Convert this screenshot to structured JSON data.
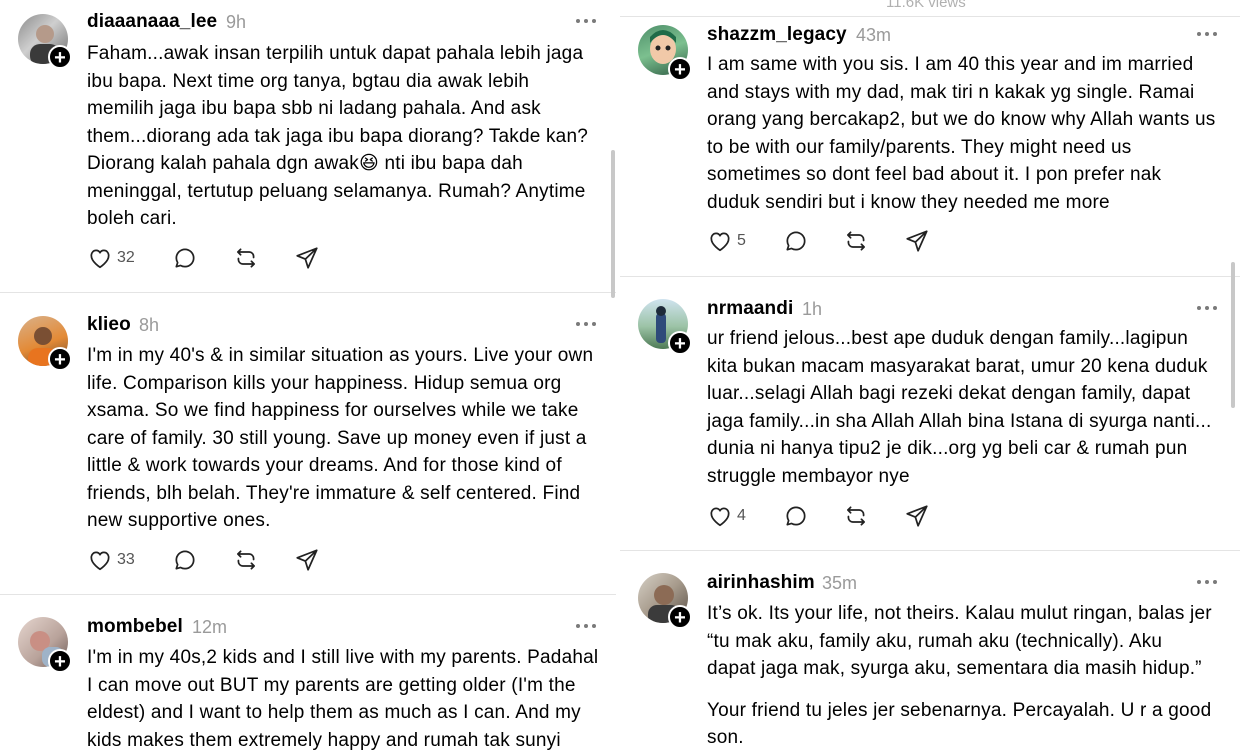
{
  "left_posts": [
    {
      "username": "diaaanaaa_lee",
      "time": "9h",
      "lines": [
        "Faham...awak insan terpilih untuk dapat pahala lebih jaga",
        "ibu bapa. Next time org tanya, bgtau dia awak lebih",
        "memilih jaga ibu bapa sbb ni ladang pahala. And ask",
        "them...diorang ada tak jaga ibu bapa diorang? Takde kan?",
        "Diorang kalah pahala dgn awak😆 nti ibu bapa dah",
        "meninggal, tertutup peluang selamanya. Rumah? Anytime",
        "boleh cari."
      ],
      "likes": "32"
    },
    {
      "username": "klieo",
      "time": "8h",
      "lines": [
        "I'm in my 40's & in similar situation as yours. Live your own",
        "life. Comparison kills your happiness. Hidup semua org",
        "xsama. So we find happiness for ourselves while we take",
        "care of family. 30 still young. Save up money even if just a",
        "little & work towards your dreams. And for those kind of",
        "friends, blh belah. They're immature & self centered. Find",
        "new supportive ones."
      ],
      "likes": "33"
    },
    {
      "username": "mombebel",
      "time": "12m",
      "lines": [
        "I'm in my 40s,2 kids and I still live with my parents. Padahal",
        "I can move out BUT my parents are getting older (I'm the",
        "eldest) and I want to help them as much as I can. And my",
        "kids makes them extremely happy and rumah tak sunyi"
      ],
      "likes": ""
    }
  ],
  "right_header": {
    "views": "11.6K views"
  },
  "right_posts": [
    {
      "username": "shazzm_legacy",
      "time": "43m",
      "lines": [
        "I am same with you sis. I am 40 this year and im married",
        "and stays with my dad, mak tiri n kakak yg single. Ramai",
        "orang yang bercakap2, but we do know why Allah wants us",
        "to be with our family/parents. They might need us",
        "sometimes so dont feel bad about it. I pon prefer nak",
        "duduk sendiri but i know they needed me more"
      ],
      "likes": "5"
    },
    {
      "username": "nrmaandi",
      "time": "1h",
      "lines": [
        "ur friend jelous...best ape duduk dengan family...lagipun",
        "kita bukan macam masyarakat barat, umur 20 kena duduk",
        "luar...selagi Allah bagi rezeki dekat dengan family, dapat",
        "jaga family...in sha Allah Allah bina Istana di syurga nanti...",
        "dunia ni hanya tipu2 je dik...org yg beli car & rumah pun",
        "struggle membayor nye"
      ],
      "likes": "4"
    },
    {
      "username": "airinhashim",
      "time": "35m",
      "lines": [
        "It’s ok. Its your life, not theirs. Kalau mulut ringan, balas jer",
        "“tu mak aku, family aku, rumah aku (technically). Aku",
        "dapat jaga mak, syurga aku, sementara dia masih hidup.”"
      ],
      "lines2": [
        "Your friend tu jeles jer sebenarnya. Percayalah. U r a good",
        "son."
      ],
      "likes": ""
    }
  ],
  "icons": {
    "like": "heart-icon",
    "comment": "comment-icon",
    "repost": "repost-icon",
    "share": "share-icon",
    "more": "more-icon",
    "follow": "plus-icon"
  },
  "colors": {
    "text": "#000000",
    "muted": "#9a9a9a",
    "separator": "#e4e4e4"
  }
}
